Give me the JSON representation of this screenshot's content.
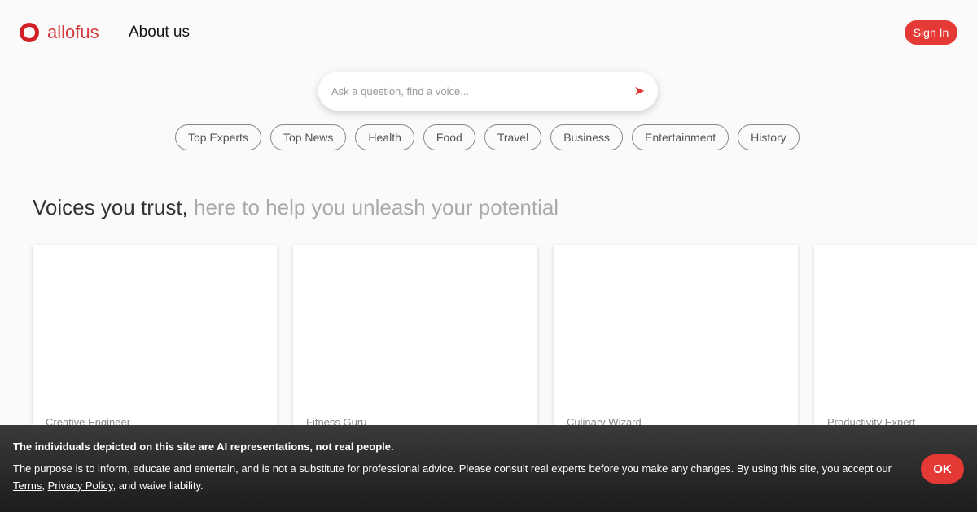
{
  "header": {
    "brand": "allofus",
    "about": "About us",
    "sign_in": "Sign In"
  },
  "search": {
    "placeholder": "Ask a question, find a voice..."
  },
  "chips": [
    "Top Experts",
    "Top News",
    "Health",
    "Food",
    "Travel",
    "Business",
    "Entertainment",
    "History"
  ],
  "headline": {
    "main": "Voices you trust,",
    "sub": " here to help you unleash your potential"
  },
  "cards": [
    "Creative Engineer",
    "Fitness Guru",
    "Culinary Wizard",
    "Productivity Expert"
  ],
  "banner": {
    "title": "The individuals depicted on this site are AI representations, not real people.",
    "text": "The purpose is to inform, educate and entertain, and is not a substitute for professional advice. Please consult real experts before you make any changes. By using this site, you accept our ",
    "terms": "Terms",
    "sep": ", ",
    "privacy": "Privacy Policy",
    "end": ", and waive liability.",
    "ok": "OK"
  },
  "colors": {
    "accent": "#e53935"
  }
}
